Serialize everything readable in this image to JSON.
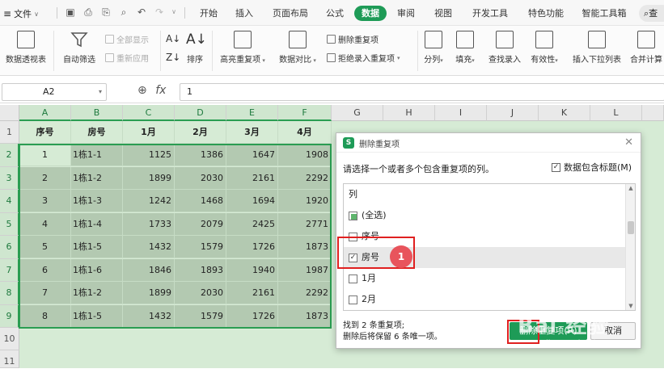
{
  "menubar": {
    "file_label": "文件",
    "tabs": [
      {
        "label": "开始",
        "active": false
      },
      {
        "label": "插入",
        "active": false
      },
      {
        "label": "页面布局",
        "active": false
      },
      {
        "label": "公式",
        "active": false
      },
      {
        "label": "数据",
        "active": true
      },
      {
        "label": "审阅",
        "active": false
      },
      {
        "label": "视图",
        "active": false
      },
      {
        "label": "开发工具",
        "active": false
      },
      {
        "label": "特色功能",
        "active": false
      },
      {
        "label": "智能工具箱",
        "active": false
      }
    ],
    "search_label": "查"
  },
  "ribbon": {
    "pivot": "数据透视表",
    "autofilter": "自动筛选",
    "show_all": "全部显示",
    "reapply": "重新应用",
    "sort": "排序",
    "highlight_dup": "高亮重复项",
    "compare": "数据对比",
    "remove_dup": "删除重复项",
    "reject_dup": "拒绝录入重复项",
    "split": "分列",
    "fill": "填充",
    "lookup": "查找录入",
    "validity": "有效性",
    "dropdown": "插入下拉列表",
    "consolidate": "合并计算"
  },
  "formula_bar": {
    "cell_ref": "A2",
    "value": "1"
  },
  "sheet": {
    "columns": [
      "A",
      "B",
      "C",
      "D",
      "E",
      "F",
      "G",
      "H",
      "I",
      "J",
      "K",
      "L"
    ],
    "rows": [
      "1",
      "2",
      "3",
      "4",
      "5",
      "6",
      "7",
      "8",
      "9",
      "10",
      "11"
    ],
    "header": [
      "序号",
      "房号",
      "1月",
      "2月",
      "3月",
      "4月"
    ],
    "data": [
      [
        "1",
        "1栋1-1",
        "1125",
        "1386",
        "1647",
        "1908"
      ],
      [
        "2",
        "1栋1-2",
        "1899",
        "2030",
        "2161",
        "2292"
      ],
      [
        "3",
        "1栋1-3",
        "1242",
        "1468",
        "1694",
        "1920"
      ],
      [
        "4",
        "1栋1-4",
        "1733",
        "2079",
        "2425",
        "2771"
      ],
      [
        "5",
        "1栋1-5",
        "1432",
        "1579",
        "1726",
        "1873"
      ],
      [
        "6",
        "1栋1-6",
        "1846",
        "1893",
        "1940",
        "1987"
      ],
      [
        "7",
        "1栋1-2",
        "1899",
        "2030",
        "2161",
        "2292"
      ],
      [
        "8",
        "1栋1-5",
        "1432",
        "1579",
        "1726",
        "1873"
      ]
    ]
  },
  "dialog": {
    "title": "删除重复项",
    "prompt": "请选择一个或者多个包含重复项的列。",
    "header_checkbox_label": "数据包含标题(M)",
    "list_header": "列",
    "items": [
      {
        "label": "(全选)",
        "state": "partial"
      },
      {
        "label": "序号",
        "state": "unchecked"
      },
      {
        "label": "房号",
        "state": "checked"
      },
      {
        "label": "1月",
        "state": "unchecked"
      },
      {
        "label": "2月",
        "state": "unchecked"
      }
    ],
    "found_line1": "找到 2 条重复项;",
    "found_line2": "删除后将保留 6 条唯一项。",
    "delete_button": "删除重复项(R)",
    "cancel_button": "取消"
  },
  "annotation": {
    "step": "1"
  },
  "watermark": {
    "main": "Bai 经验",
    "sub": "jingyan.baidu.com"
  },
  "colors": {
    "accent": "#1e9b57",
    "selection": "#2a9d52",
    "highlight_red": "#e02020",
    "badge": "#e8545c"
  }
}
